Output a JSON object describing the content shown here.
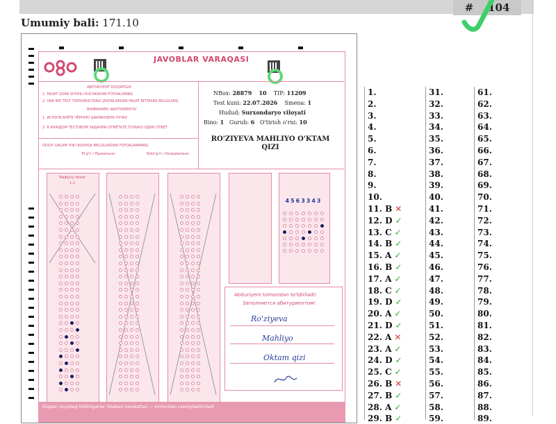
{
  "header": {
    "id_prefix": "#",
    "id_tail": "104",
    "score_label": "Umumiy bali:",
    "score_value": "171.10"
  },
  "sheet": {
    "title": "JAVOBLAR VARAQASI",
    "nbox_label": "NBox:",
    "nbox_value": "28879",
    "nbox_num": "10",
    "tip_label": "TIP:",
    "tip_value": "11209",
    "test_kuni_label": "Test kuni:",
    "test_kuni_value": "22.07.2026",
    "smena_label": "Smena:",
    "smena_value": "1",
    "hudud_label": "Hudud:",
    "hudud_value": "Surxondaryo viloyati",
    "bino_label": "Bino:",
    "bino_value": "1",
    "guruh_label": "Guruh:",
    "guruh_value": "6",
    "orin_label": "O'tirish o'rni:",
    "orin_value": "10",
    "fullname_1": "RO'ZIYEVA MAHLIYO O'KTAM",
    "fullname_2": "QIZI",
    "col1_head": "Majburiy fanlar",
    "col1_sub": "1,1",
    "code_digits": "4563343",
    "sig_box_title": "Abituriyent tomonidan to'ldiriladi!",
    "sig_box_title_ru": "Заполняется абитуриентом!",
    "sig_1": "Ro'ziyeva",
    "sig_2": "Mahliyo",
    "sig_3": "Oktam qizi",
    "bottom_note": "Diqqat! Quyidagi bildirilganlar Talabani harakatlari — tomonidan rasmiylashtiriladi"
  },
  "answers": {
    "col1": [
      {
        "n": "1.",
        "a": "",
        "m": ""
      },
      {
        "n": "2.",
        "a": "",
        "m": ""
      },
      {
        "n": "3.",
        "a": "",
        "m": ""
      },
      {
        "n": "4.",
        "a": "",
        "m": ""
      },
      {
        "n": "5.",
        "a": "",
        "m": ""
      },
      {
        "n": "6.",
        "a": "",
        "m": ""
      },
      {
        "n": "7.",
        "a": "",
        "m": ""
      },
      {
        "n": "8.",
        "a": "",
        "m": ""
      },
      {
        "n": "9.",
        "a": "",
        "m": ""
      },
      {
        "n": "10.",
        "a": "",
        "m": ""
      },
      {
        "n": "11.",
        "a": "B",
        "m": "✕"
      },
      {
        "n": "12.",
        "a": "D",
        "m": "✓"
      },
      {
        "n": "13.",
        "a": "C",
        "m": "✓"
      },
      {
        "n": "14.",
        "a": "B",
        "m": "✓"
      },
      {
        "n": "15.",
        "a": "A",
        "m": "✓"
      },
      {
        "n": "16.",
        "a": "B",
        "m": "✓"
      },
      {
        "n": "17.",
        "a": "A",
        "m": "✓"
      },
      {
        "n": "18.",
        "a": "C",
        "m": "✓"
      },
      {
        "n": "19.",
        "a": "D",
        "m": "✓"
      },
      {
        "n": "20.",
        "a": "A",
        "m": "✓"
      },
      {
        "n": "21.",
        "a": "D",
        "m": "✓"
      },
      {
        "n": "22.",
        "a": "A",
        "m": "✕"
      },
      {
        "n": "23.",
        "a": "A",
        "m": "✓"
      },
      {
        "n": "24.",
        "a": "D",
        "m": "✓"
      },
      {
        "n": "25.",
        "a": "C",
        "m": "✓"
      },
      {
        "n": "26.",
        "a": "B",
        "m": "✕"
      },
      {
        "n": "27.",
        "a": "B",
        "m": "✓"
      },
      {
        "n": "28.",
        "a": "A",
        "m": "✓"
      },
      {
        "n": "29.",
        "a": "B",
        "m": "✓"
      }
    ],
    "col2": [
      "31.",
      "32.",
      "33.",
      "34.",
      "35.",
      "36.",
      "37.",
      "38.",
      "39.",
      "40.",
      "41.",
      "42.",
      "43.",
      "44.",
      "45.",
      "46.",
      "47.",
      "48.",
      "49.",
      "50.",
      "51.",
      "52.",
      "53.",
      "54.",
      "55.",
      "56.",
      "57.",
      "58.",
      "59."
    ],
    "col3": [
      "61.",
      "62.",
      "63.",
      "64.",
      "65.",
      "66.",
      "67.",
      "68.",
      "69.",
      "70.",
      "71.",
      "72.",
      "73.",
      "74.",
      "75.",
      "76.",
      "77.",
      "78.",
      "79.",
      "80.",
      "81.",
      "82.",
      "83.",
      "84.",
      "85.",
      "86.",
      "87.",
      "88.",
      "89."
    ]
  },
  "colors": {
    "ok": "#3aa33a",
    "bad": "#d23a3a",
    "pink": "#e38ca5"
  }
}
